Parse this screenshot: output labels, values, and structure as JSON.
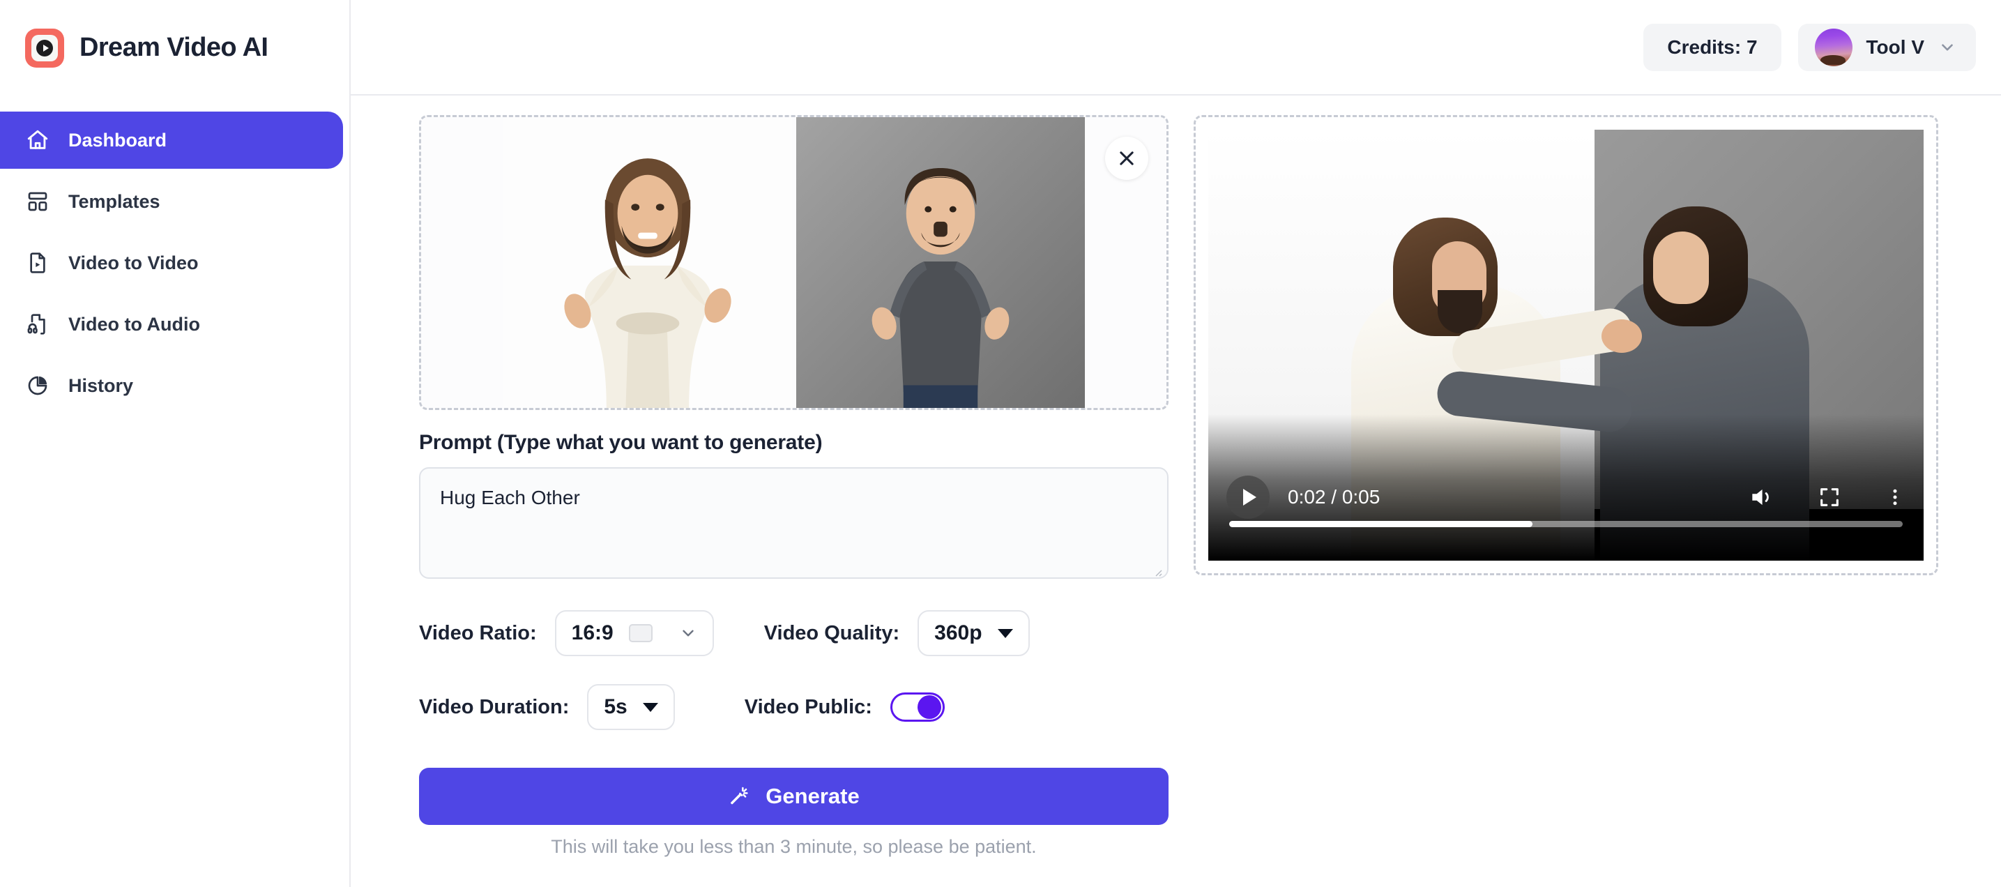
{
  "brand": {
    "name": "Dream Video AI",
    "logo_icon": "play-badge-icon",
    "logo_color": "#F4695F"
  },
  "sidebar": {
    "items": [
      {
        "label": "Dashboard",
        "icon": "home-icon",
        "active": true
      },
      {
        "label": "Templates",
        "icon": "layout-template-icon",
        "active": false
      },
      {
        "label": "Video to Video",
        "icon": "file-video-icon",
        "active": false
      },
      {
        "label": "Video to Audio",
        "icon": "file-audio-icon",
        "active": false
      },
      {
        "label": "History",
        "icon": "pie-chart-icon",
        "active": false
      }
    ],
    "active_color": "#4F46E5"
  },
  "topbar": {
    "credits_label": "Credits: 7",
    "user_name": "Tool V",
    "user_chevron_icon": "chevron-down-icon",
    "avatar_icon": "user-avatar"
  },
  "upload": {
    "close_icon": "close-icon",
    "images": [
      {
        "alt": "first-reference-image"
      },
      {
        "alt": "second-reference-image"
      }
    ]
  },
  "prompt": {
    "label": "Prompt  (Type what you want to generate)",
    "value": "Hug Each Other",
    "placeholder": "Hug Each Other"
  },
  "controls": {
    "ratio_label": "Video Ratio:",
    "ratio_value": "16:9",
    "ratio_chevron_icon": "chevron-down-icon",
    "quality_label": "Video Quality:",
    "quality_value": "360p",
    "quality_caret_icon": "caret-down-icon",
    "duration_label": "Video Duration:",
    "duration_value": "5s",
    "duration_caret_icon": "caret-down-icon",
    "public_label": "Video Public:",
    "public_enabled": "on",
    "toggle_color": "#5B16F0"
  },
  "generate": {
    "label": "Generate",
    "icon": "magic-wand-icon",
    "note": "This will take you less than 3 minute, so please be patient.",
    "color": "#4F46E5"
  },
  "video": {
    "current_time": "0:02",
    "total_time": "0:05",
    "time_display": "0:02 / 0:05",
    "progress_percent": "45",
    "play_icon": "play-icon",
    "volume_icon": "volume-icon",
    "fullscreen_icon": "fullscreen-icon",
    "more_icon": "more-vertical-icon"
  }
}
